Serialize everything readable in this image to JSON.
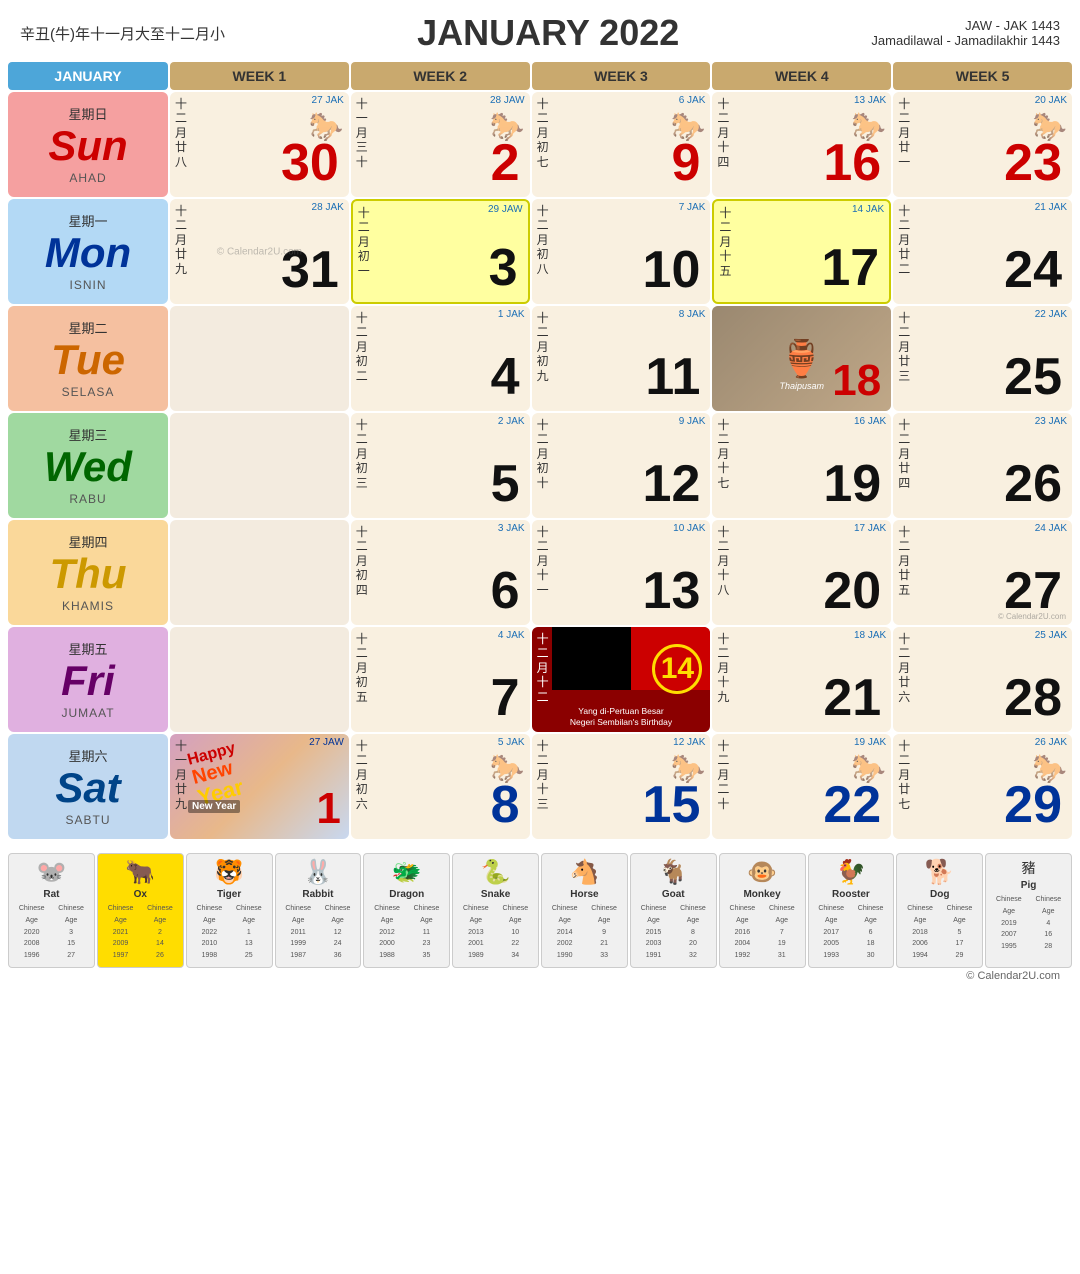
{
  "header": {
    "subtitle_left": "辛丑(牛)年十一月大至十二月小",
    "title": "JANUARY 2022",
    "subtitle_right_line1": "JAW - JAK 1443",
    "subtitle_right_line2": "Jamadilawal - Jamadilakhir 1443"
  },
  "weeks": {
    "col0": "JANUARY",
    "col1": "WEEK 1",
    "col2": "WEEK 2",
    "col3": "WEEK 3",
    "col4": "WEEK 4",
    "col5": "WEEK 5"
  },
  "days": [
    {
      "zh": "星期日",
      "en": "Sun",
      "ms": "AHAD",
      "class": "dl-sun"
    },
    {
      "zh": "星期一",
      "en": "Mon",
      "ms": "ISNIN",
      "class": "dl-mon"
    },
    {
      "zh": "星期二",
      "en": "Tue",
      "ms": "SELASA",
      "class": "dl-tue"
    },
    {
      "zh": "星期三",
      "en": "Wed",
      "ms": "RABU",
      "class": "dl-wed"
    },
    {
      "zh": "星期四",
      "en": "Thu",
      "ms": "KHAMIS",
      "class": "dl-thu"
    },
    {
      "zh": "星期五",
      "en": "Fri",
      "ms": "JUMAAT",
      "class": "dl-fri"
    },
    {
      "zh": "星期六",
      "en": "Sat",
      "ms": "SABTU",
      "class": "dl-sat"
    }
  ],
  "zodiac": [
    {
      "name": "Rat",
      "icon": "🐭",
      "highlighted": false
    },
    {
      "name": "Ox",
      "icon": "🐂",
      "highlighted": true
    },
    {
      "name": "Tiger",
      "icon": "🐯",
      "highlighted": false
    },
    {
      "name": "Rabbit",
      "icon": "🐰",
      "highlighted": false
    },
    {
      "name": "Dragon",
      "icon": "🐲",
      "highlighted": false
    },
    {
      "name": "Snake",
      "icon": "🐍",
      "highlighted": false
    },
    {
      "name": "Horse",
      "icon": "🐴",
      "highlighted": false
    },
    {
      "name": "Goat",
      "icon": "🐐",
      "highlighted": false
    },
    {
      "name": "Monkey",
      "icon": "🐵",
      "highlighted": false
    },
    {
      "name": "Rooster",
      "icon": "🐓",
      "highlighted": false
    },
    {
      "name": "Dog",
      "icon": "🐕",
      "highlighted": false
    },
    {
      "name": "Pig",
      "icon": "豬",
      "highlighted": false
    }
  ]
}
